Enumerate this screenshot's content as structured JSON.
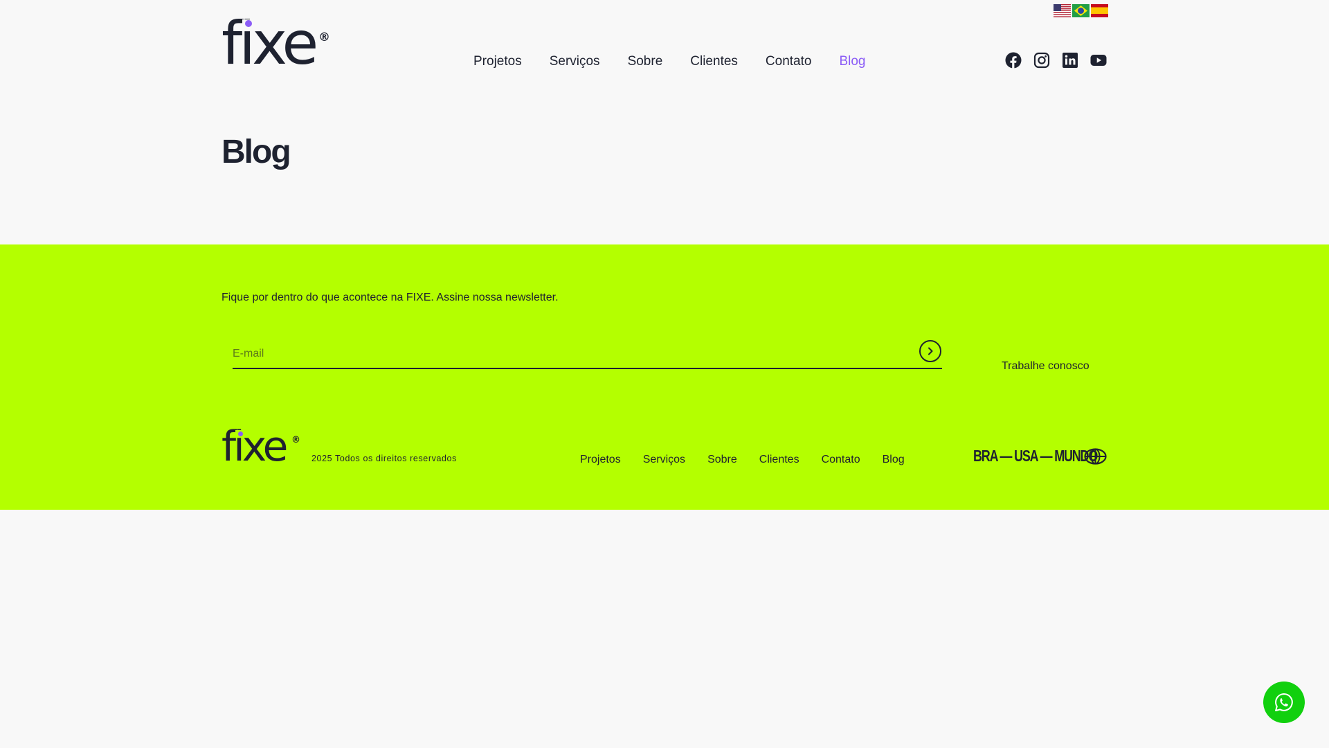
{
  "brand": {
    "name": "fixe",
    "registered": "®"
  },
  "languages": [
    {
      "code": "en",
      "icon": "us-flag-icon"
    },
    {
      "code": "pt",
      "icon": "brazil-flag-icon"
    },
    {
      "code": "es",
      "icon": "spain-flag-icon"
    }
  ],
  "nav": {
    "items": [
      "Projetos",
      "Serviços",
      "Sobre",
      "Clientes",
      "Contato",
      "Blog"
    ],
    "active": "Blog"
  },
  "social": [
    "facebook-icon",
    "instagram-icon",
    "linkedin-icon",
    "youtube-icon"
  ],
  "page": {
    "title": "Blog"
  },
  "footer": {
    "newsletter_text": "Fique por dentro do que acontece na FIXE. Assine nossa newsletter.",
    "email_placeholder": "E-mail",
    "email_value": "",
    "work_link": "Trabalhe conosco",
    "copyright": "2025 Todos os direitos reservados",
    "nav": [
      "Projetos",
      "Serviços",
      "Sobre",
      "Clientes",
      "Contato",
      "Blog"
    ],
    "regions": "BRA — USA — MUNDO"
  },
  "colors": {
    "accent": "#8b5cf6",
    "footer_bg": "#b4ff00",
    "text": "#1e2230",
    "whatsapp": "#11d00e",
    "background": "#f8f8f8"
  },
  "floating": {
    "icon": "whatsapp-icon"
  }
}
